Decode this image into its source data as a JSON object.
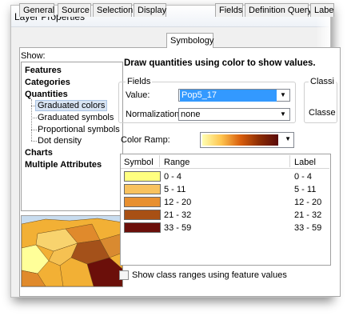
{
  "window": {
    "title": "Layer Properties"
  },
  "tabs": [
    {
      "label": "General"
    },
    {
      "label": "Source"
    },
    {
      "label": "Selection"
    },
    {
      "label": "Display"
    },
    {
      "label": "Symbology"
    },
    {
      "label": "Fields"
    },
    {
      "label": "Definition Query"
    },
    {
      "label": "Labe"
    }
  ],
  "active_tab": "Symbology",
  "show": {
    "label": "Show:",
    "items": [
      {
        "label": "Features"
      },
      {
        "label": "Categories"
      },
      {
        "label": "Quantities"
      },
      {
        "label": "Graduated colors"
      },
      {
        "label": "Graduated symbols"
      },
      {
        "label": "Proportional symbols"
      },
      {
        "label": "Dot density"
      },
      {
        "label": "Charts"
      },
      {
        "label": "Multiple Attributes"
      }
    ],
    "selected": "Graduated colors"
  },
  "main": {
    "heading": "Draw quantities using color to show values."
  },
  "fields": {
    "group_label": "Fields",
    "value_label": "Value:",
    "value": "Pop5_17",
    "normalization_label": "Normalization:",
    "normalization": "none"
  },
  "classification": {
    "group_label": "Classi",
    "classes_label": "Classe"
  },
  "color_ramp": {
    "label": "Color Ramp:",
    "colors": [
      "#ffffb0",
      "#fec44f",
      "#d95f0e",
      "#8c2d04",
      "#5a0a0a"
    ]
  },
  "table": {
    "headers": {
      "symbol": "Symbol",
      "range": "Range",
      "label": "Label"
    },
    "rows": [
      {
        "color": "#ffff80",
        "range": "0 - 4",
        "label": "0 - 4"
      },
      {
        "color": "#f8c25e",
        "range": "5 - 11",
        "label": "5 - 11"
      },
      {
        "color": "#e89030",
        "range": "12 - 20",
        "label": "12 - 20"
      },
      {
        "color": "#a85014",
        "range": "21 - 32",
        "label": "21 - 32"
      },
      {
        "color": "#6b0f0a",
        "range": "33 - 59",
        "label": "33 - 59"
      }
    ]
  },
  "option": {
    "show_class_ranges_label": "Show class ranges using feature values",
    "checked": false
  },
  "icons": {
    "dropdown": "chevron-down-icon"
  }
}
